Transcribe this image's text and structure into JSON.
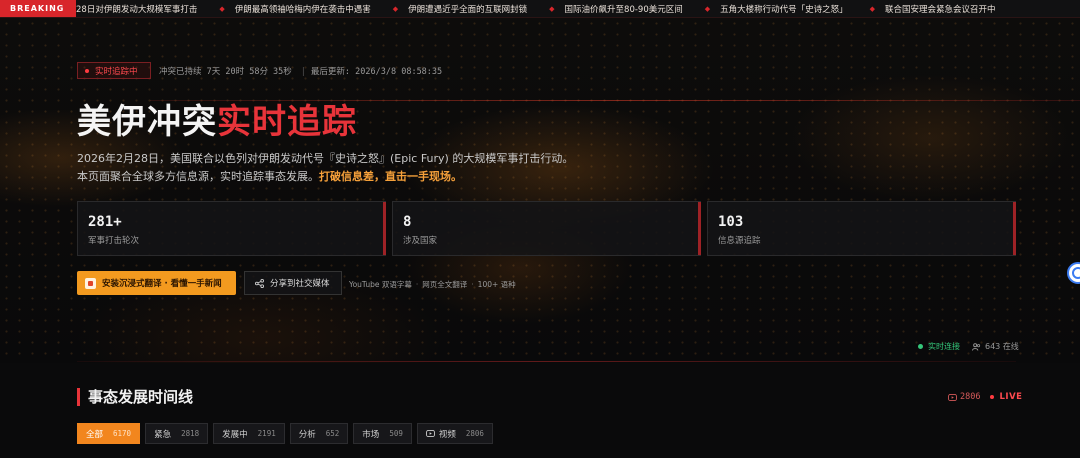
{
  "ticker": {
    "badge": "BREAKING",
    "items": [
      "28日对伊朗发动大规模军事打击",
      "伊朗最高领袖哈梅内伊在袭击中遇害",
      "伊朗遭遇近乎全面的互联网封锁",
      "国际油价飙升至80-90美元区间",
      "五角大楼称行动代号「史诗之怒」",
      "联合国安理会紧急会议召开中"
    ]
  },
  "status": {
    "live_badge": "实时追踪中",
    "duration": "冲突已持续 7天 20时 58分 35秒",
    "separator": "|",
    "last_update": "最后更新: 2026/3/8 08:58:35"
  },
  "hero": {
    "title_main": "美伊冲突",
    "title_accent": "实时追踪",
    "desc_line": "2026年2月28日，美国联合以色列对伊朗发动代号『史诗之怒』(Epic Fury) 的大规模军事打击行动。本页面聚合全球多方信息源，实时追踪事态发展。",
    "desc_highlight": "打破信息差，直击一手现场。"
  },
  "stats": [
    {
      "value": "281+",
      "label": "军事打击轮次"
    },
    {
      "value": "8",
      "label": "涉及国家"
    },
    {
      "value": "103",
      "label": "信息源追踪"
    }
  ],
  "actions": {
    "install_label": "安装沉浸式翻译 · 看懂一手新闻",
    "share_label": "分享到社交媒体",
    "note_1": "YouTube 双语字幕",
    "note_2": "网页全文翻译",
    "note_3": "100+ 语种",
    "note_dot": "·"
  },
  "connection": {
    "status": "实时连接",
    "online": "643 在线"
  },
  "timeline": {
    "title": "事态发展时间线",
    "count": "2806",
    "live": "LIVE",
    "filters": [
      {
        "label": "全部",
        "count": "6170",
        "active": true
      },
      {
        "label": "紧急",
        "count": "2818",
        "active": false
      },
      {
        "label": "发展中",
        "count": "2191",
        "active": false
      },
      {
        "label": "分析",
        "count": "652",
        "active": false
      },
      {
        "label": "市场",
        "count": "509",
        "active": false
      },
      {
        "label": "视频",
        "count": "2806",
        "active": false
      }
    ]
  },
  "colors": {
    "accent_red": "#e8343a",
    "accent_orange": "#f39a1f",
    "online_green": "#35c77a"
  }
}
